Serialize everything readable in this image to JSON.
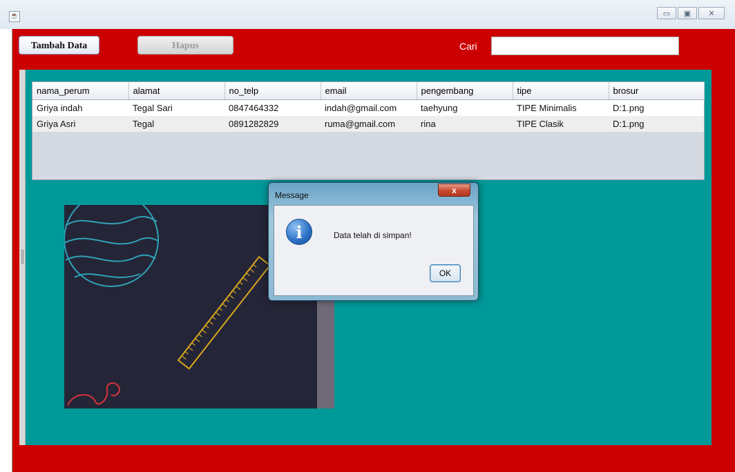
{
  "window": {
    "title": "",
    "controls": [
      "minimize-icon",
      "maximize-icon",
      "close-icon"
    ]
  },
  "toolbar": {
    "tambah_label": "Tambah Data",
    "hapus_label": "Hapus",
    "cari_label": "Cari",
    "cari_value": ""
  },
  "table": {
    "columns": [
      "nama_perum",
      "alamat",
      "no_telp",
      "email",
      "pengembang",
      "tipe",
      "brosur"
    ],
    "rows": [
      [
        "Griya indah",
        "Tegal Sari",
        "0847464332",
        "indah@gmail.com",
        "taehyung",
        "TIPE Minimalis",
        "D:1.png"
      ],
      [
        "Griya Asri",
        "Tegal",
        "0891282829",
        "ruma@gmail.com",
        "rina",
        "TIPE Clasik",
        "D:1.png"
      ]
    ]
  },
  "dialog": {
    "title": "Message",
    "message": "Data telah di simpan!",
    "ok_label": "OK",
    "close_glyph": "x",
    "icon": "info-icon"
  },
  "colors": {
    "frame_background": "#cc0000",
    "panel_background": "#009999"
  }
}
